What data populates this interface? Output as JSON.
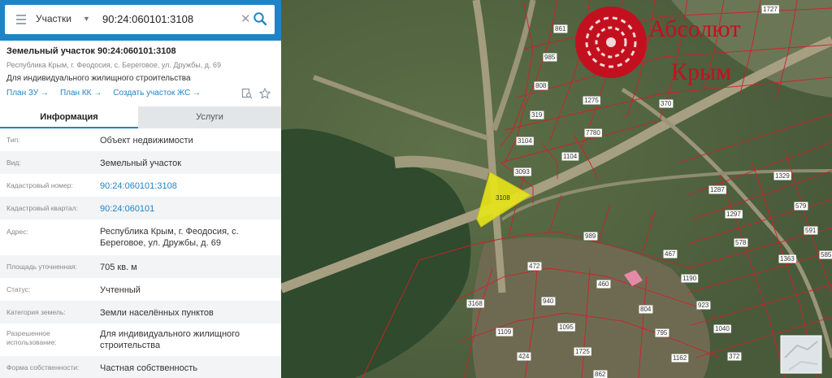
{
  "search": {
    "type_label": "Участки",
    "query": "90:24:060101:3108",
    "clear_glyph": "✕"
  },
  "collapse_glyph": "‹",
  "parcel": {
    "title": "Земельный участок 90:24:060101:3108",
    "address_short": "Республика Крым, г. Феодосия, с. Береговое, ул. Дружбы, д. 69",
    "purpose": "Для индивидуального жилищного строительства"
  },
  "links": [
    {
      "label": "План ЗУ →"
    },
    {
      "label": "План КК →"
    },
    {
      "label": "Создать участок ЖС →"
    }
  ],
  "tabs": {
    "info": "Информация",
    "services": "Услуги"
  },
  "rows": [
    {
      "label": "Тип:",
      "value": "Объект недвижимости"
    },
    {
      "label": "Вид:",
      "value": "Земельный участок"
    },
    {
      "label": "Кадастровый номер:",
      "value": "90:24:060101:3108"
    },
    {
      "label": "Кадастровый квартал:",
      "value": "90:24:060101"
    },
    {
      "label": "Адрес:",
      "value": "Республика Крым, г. Феодосия, с. Береговое, ул. Дружбы, д. 69"
    },
    {
      "label": "Площадь уточненная:",
      "value": "705 кв. м"
    },
    {
      "label": "Статус:",
      "value": "Учтенный"
    },
    {
      "label": "Категория земель:",
      "value": "Земли населённых пунктов"
    },
    {
      "label": "Разрешенное использование:",
      "value": "Для индивидуального жилищного строительства"
    },
    {
      "label": "Форма собственности:",
      "value": "Частная собственность"
    }
  ],
  "map": {
    "parcel_labels": [
      "861",
      "985",
      "808",
      "1275",
      "319",
      "7780",
      "3104",
      "1104",
      "3093",
      "3108",
      "370",
      "1329",
      "1287",
      "1297",
      "579",
      "578",
      "591",
      "1363",
      "989",
      "467",
      "472",
      "460",
      "1190",
      "3168",
      "940",
      "804",
      "923",
      "1095",
      "1109",
      "795",
      "1040",
      "1725",
      "1162",
      "372",
      "424",
      "862",
      "1727",
      "585"
    ],
    "selected_parcel": "3108",
    "logo_line1": "Абсолют",
    "logo_line2": "Крым",
    "colors": {
      "accent": "#1f84c6",
      "selected_parcel": "#e8e61a",
      "boundary": "#d0202a",
      "logo": "#c3101f"
    }
  }
}
